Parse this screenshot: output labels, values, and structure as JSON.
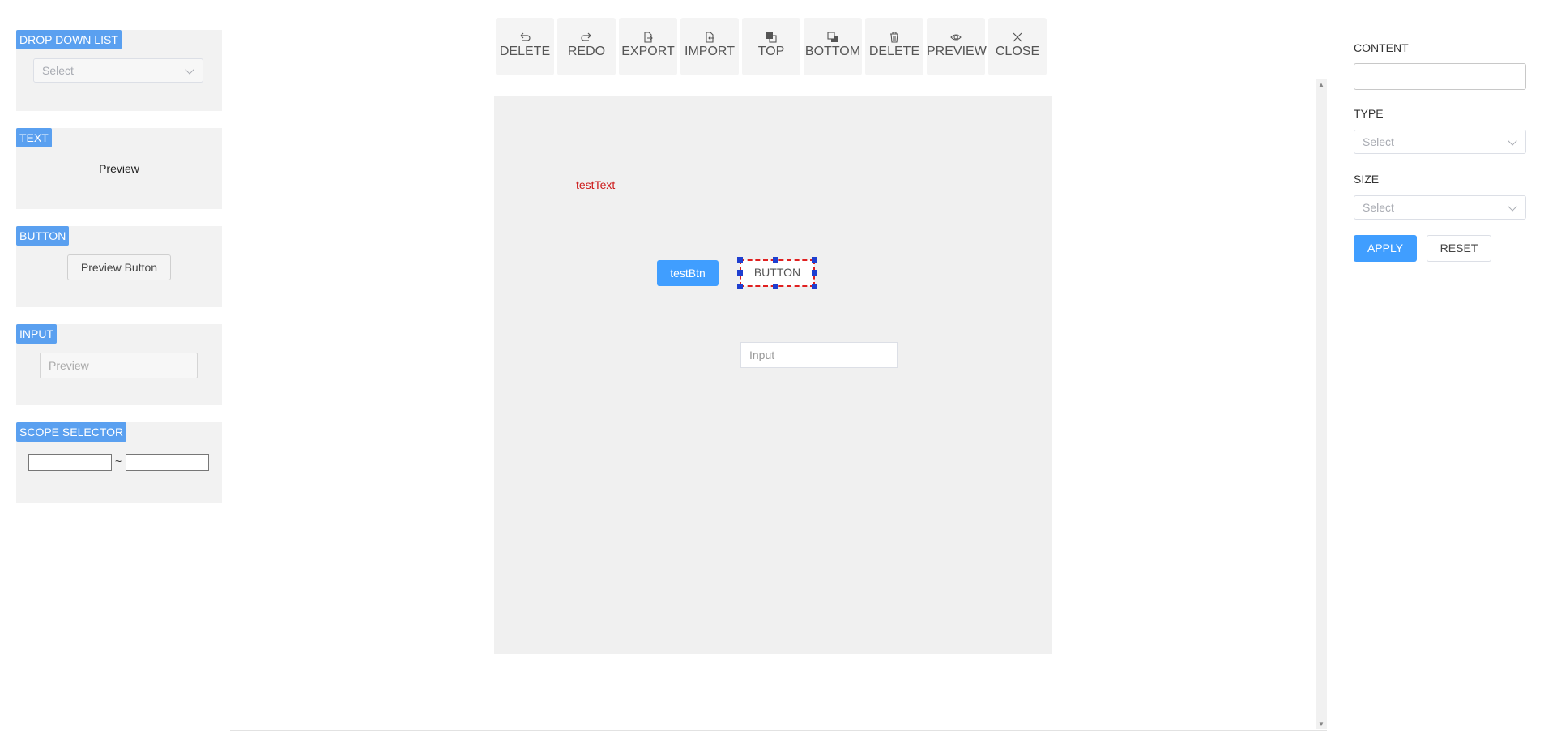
{
  "palette": {
    "dropdown": {
      "tag": "DROP DOWN LIST",
      "placeholder": "Select"
    },
    "text": {
      "tag": "TEXT",
      "preview": "Preview"
    },
    "button": {
      "tag": "BUTTON",
      "preview": "Preview Button"
    },
    "input": {
      "tag": "INPUT",
      "placeholder": "Preview"
    },
    "scope": {
      "tag": "SCOPE SELECTOR",
      "separator": "~"
    }
  },
  "toolbar": [
    {
      "label": "DELETE",
      "icon": "undo-icon"
    },
    {
      "label": "REDO",
      "icon": "redo-icon"
    },
    {
      "label": "EXPORT",
      "icon": "export-icon"
    },
    {
      "label": "IMPORT",
      "icon": "import-icon"
    },
    {
      "label": "TOP",
      "icon": "bring-to-top-icon"
    },
    {
      "label": "BOTTOM",
      "icon": "send-to-bottom-icon"
    },
    {
      "label": "DELETE",
      "icon": "trash-icon"
    },
    {
      "label": "PREVIEW",
      "icon": "eye-icon"
    },
    {
      "label": "CLOSE",
      "icon": "close-icon"
    }
  ],
  "canvas": {
    "text": "testText",
    "primary_button": "testBtn",
    "selected_button": "BUTTON",
    "input_placeholder": "Input"
  },
  "props": {
    "content_label": "CONTENT",
    "type_label": "TYPE",
    "type_placeholder": "Select",
    "size_label": "SIZE",
    "size_placeholder": "Select",
    "apply": "APPLY",
    "reset": "RESET"
  },
  "colors": {
    "accent": "#409eff",
    "tag": "#5aa0f0",
    "canvas_text": "#cc1a1a",
    "selection_border": "#e02020",
    "handle": "#1f3fd0"
  }
}
